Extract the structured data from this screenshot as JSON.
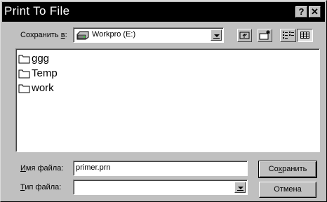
{
  "window": {
    "title": "Print To File"
  },
  "title_buttons": {
    "help": "?",
    "close": "✕"
  },
  "save_in": {
    "label_prefix": "Сохранить ",
    "label_accel": "в",
    "label_suffix": ":",
    "value": "Workpro (E:)"
  },
  "folders": [
    {
      "name": "ggg"
    },
    {
      "name": "Temp"
    },
    {
      "name": "work"
    }
  ],
  "file_name": {
    "label_accel": "И",
    "label_rest": "мя файла:",
    "value": "primer.prn"
  },
  "file_type": {
    "label_accel": "Т",
    "label_rest": "ип файла:",
    "value": ""
  },
  "buttons": {
    "save_prefix": "Со",
    "save_accel": "х",
    "save_suffix": "ранить",
    "cancel": "Отмена"
  },
  "icons": {
    "drive": "hard-drive-icon",
    "up": "up-one-level-icon",
    "new_folder": "new-folder-icon",
    "list": "list-view-icon",
    "details": "details-view-icon",
    "folder": "folder-icon"
  }
}
